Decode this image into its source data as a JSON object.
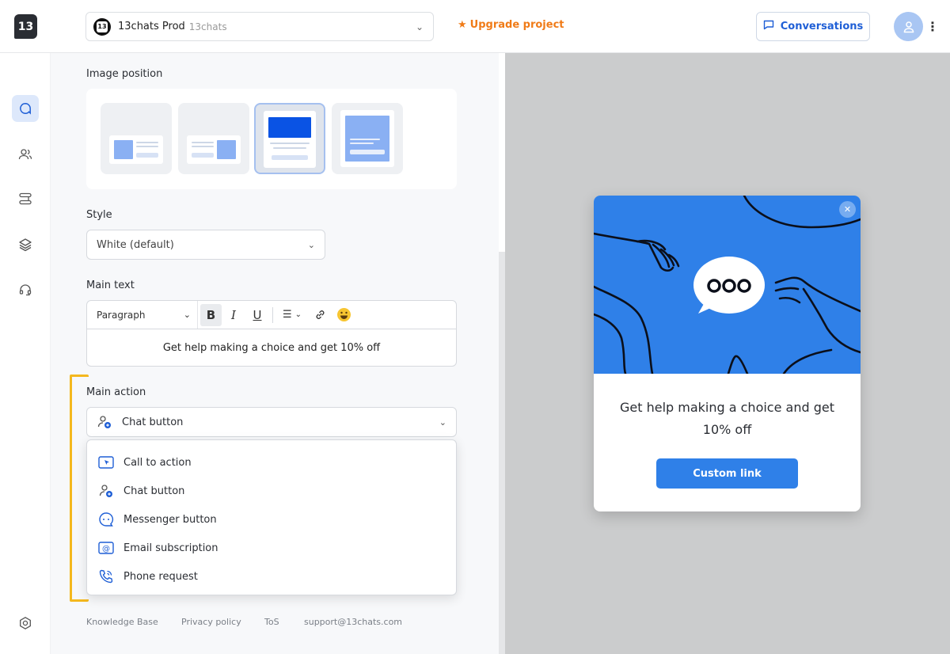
{
  "header": {
    "logo_text": "13",
    "project_name": "13chats Prod",
    "project_sub": "13chats",
    "upgrade_label": "Upgrade project",
    "conversations_label": "Conversations"
  },
  "settings": {
    "image_position_label": "Image position",
    "style_label": "Style",
    "style_value": "White (default)",
    "main_text_label": "Main text",
    "paragraph_value": "Paragraph",
    "editor_text": "Get help making a choice and get 10% off",
    "main_action_label": "Main action",
    "main_action_value": "Chat button",
    "action_options": [
      "Call to action",
      "Chat button",
      "Messenger button",
      "Email subscription",
      "Phone request"
    ]
  },
  "footer": {
    "links": [
      "Knowledge Base",
      "Privacy policy",
      "ToS",
      "support@13chats.com"
    ]
  },
  "preview": {
    "popup_text": "Get help making a choice and get 10% off",
    "button_label": "Custom link"
  },
  "colors": {
    "accent": "#2f80e8",
    "upgrade": "#f07b17",
    "highlight": "#f4b81e"
  }
}
